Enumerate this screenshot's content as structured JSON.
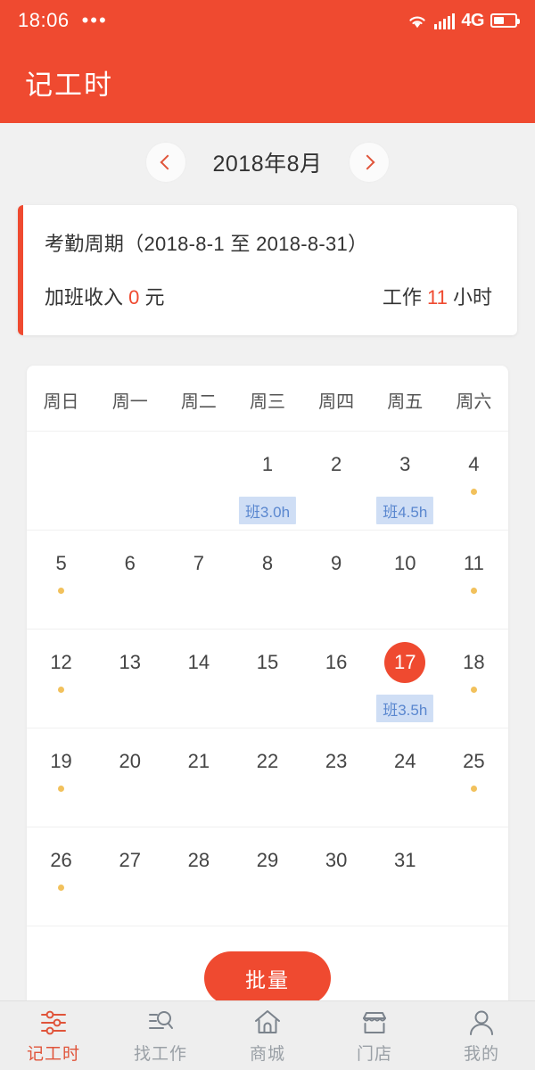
{
  "status_bar": {
    "time": "18:06",
    "dots": "•••",
    "network": "4G",
    "icons": {
      "wifi": "wifi-icon",
      "signal": "signal-bars-icon",
      "battery": "battery-icon"
    }
  },
  "app_bar": {
    "title": "记工时"
  },
  "month_nav": {
    "prev_label": "‹",
    "next_label": "›",
    "month_label": "2018年8月"
  },
  "summary": {
    "title": "考勤周期（2018-8-1 至 2018-8-31）",
    "overtime_prefix": "加班收入",
    "overtime_value": "0",
    "overtime_suffix": "元",
    "work_prefix": "工作",
    "work_value": "11",
    "work_suffix": "小时"
  },
  "calendar": {
    "weekdays": [
      "周日",
      "周一",
      "周二",
      "周三",
      "周四",
      "周五",
      "周六"
    ],
    "weeks": [
      [
        {
          "day": "",
          "dot": false,
          "badge": "",
          "selected": false
        },
        {
          "day": "",
          "dot": false,
          "badge": "",
          "selected": false
        },
        {
          "day": "",
          "dot": false,
          "badge": "",
          "selected": false
        },
        {
          "day": "1",
          "dot": false,
          "badge": "班3.0h",
          "selected": false
        },
        {
          "day": "2",
          "dot": false,
          "badge": "",
          "selected": false
        },
        {
          "day": "3",
          "dot": false,
          "badge": "班4.5h",
          "selected": false
        },
        {
          "day": "4",
          "dot": true,
          "badge": "",
          "selected": false
        }
      ],
      [
        {
          "day": "5",
          "dot": true,
          "badge": "",
          "selected": false
        },
        {
          "day": "6",
          "dot": false,
          "badge": "",
          "selected": false
        },
        {
          "day": "7",
          "dot": false,
          "badge": "",
          "selected": false
        },
        {
          "day": "8",
          "dot": false,
          "badge": "",
          "selected": false
        },
        {
          "day": "9",
          "dot": false,
          "badge": "",
          "selected": false
        },
        {
          "day": "10",
          "dot": false,
          "badge": "",
          "selected": false
        },
        {
          "day": "11",
          "dot": true,
          "badge": "",
          "selected": false
        }
      ],
      [
        {
          "day": "12",
          "dot": true,
          "badge": "",
          "selected": false
        },
        {
          "day": "13",
          "dot": false,
          "badge": "",
          "selected": false
        },
        {
          "day": "14",
          "dot": false,
          "badge": "",
          "selected": false
        },
        {
          "day": "15",
          "dot": false,
          "badge": "",
          "selected": false
        },
        {
          "day": "16",
          "dot": false,
          "badge": "",
          "selected": false
        },
        {
          "day": "17",
          "dot": false,
          "badge": "班3.5h",
          "selected": true
        },
        {
          "day": "18",
          "dot": true,
          "badge": "",
          "selected": false
        }
      ],
      [
        {
          "day": "19",
          "dot": true,
          "badge": "",
          "selected": false
        },
        {
          "day": "20",
          "dot": false,
          "badge": "",
          "selected": false
        },
        {
          "day": "21",
          "dot": false,
          "badge": "",
          "selected": false
        },
        {
          "day": "22",
          "dot": false,
          "badge": "",
          "selected": false
        },
        {
          "day": "23",
          "dot": false,
          "badge": "",
          "selected": false
        },
        {
          "day": "24",
          "dot": false,
          "badge": "",
          "selected": false
        },
        {
          "day": "25",
          "dot": true,
          "badge": "",
          "selected": false
        }
      ],
      [
        {
          "day": "26",
          "dot": true,
          "badge": "",
          "selected": false
        },
        {
          "day": "27",
          "dot": false,
          "badge": "",
          "selected": false
        },
        {
          "day": "28",
          "dot": false,
          "badge": "",
          "selected": false
        },
        {
          "day": "29",
          "dot": false,
          "badge": "",
          "selected": false
        },
        {
          "day": "30",
          "dot": false,
          "badge": "",
          "selected": false
        },
        {
          "day": "31",
          "dot": false,
          "badge": "",
          "selected": false
        },
        {
          "day": "",
          "dot": false,
          "badge": "",
          "selected": false
        }
      ]
    ],
    "batch_button": "批量"
  },
  "bottom_nav": {
    "items": [
      {
        "label": "记工时",
        "icon": "sliders-icon",
        "active": true
      },
      {
        "label": "找工作",
        "icon": "job-search-icon",
        "active": false
      },
      {
        "label": "商城",
        "icon": "home-icon",
        "active": false
      },
      {
        "label": "门店",
        "icon": "store-icon",
        "active": false
      },
      {
        "label": "我的",
        "icon": "person-icon",
        "active": false
      }
    ]
  },
  "colors": {
    "brand": "#ef4a30",
    "badge_bg": "#cfdef5",
    "badge_text": "#5a87cf",
    "dot": "#f2c15c",
    "page_bg": "#f1f1f1",
    "nav_inactive": "#9aa0a6"
  }
}
